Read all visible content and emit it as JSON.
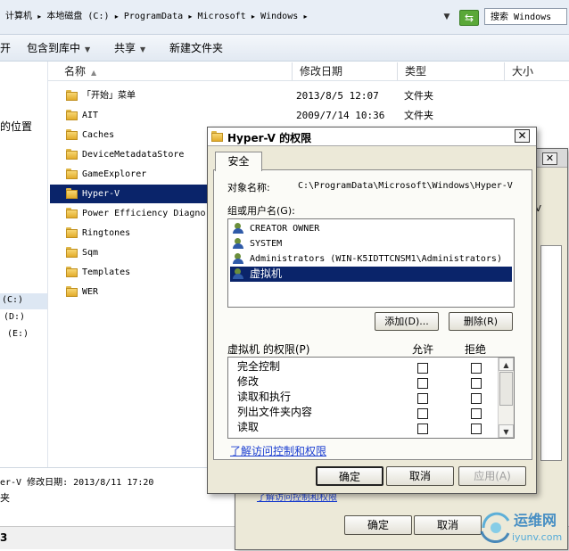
{
  "explorer": {
    "breadcrumb": [
      "计算机",
      "本地磁盘 (C:)",
      "ProgramData",
      "Microsoft",
      "Windows"
    ],
    "search_placeholder": "搜索 Windows",
    "toolbar": {
      "open": "开",
      "include_in_library": "包含到库中",
      "share": "共享",
      "new_folder": "新建文件夹"
    },
    "nav": {
      "location": "的位置",
      "drive_c": "(C:)",
      "drive_d": "(D:)",
      "drive_e": "(E:)"
    },
    "columns": {
      "name": "名称",
      "date": "修改日期",
      "type": "类型",
      "size": "大小"
    },
    "files": [
      {
        "name": "「开始」菜单",
        "date": "2013/8/5 12:07",
        "type": "文件夹"
      },
      {
        "name": "AIT",
        "date": "2009/7/14 10:36",
        "type": "文件夹"
      },
      {
        "name": "Caches"
      },
      {
        "name": "DeviceMetadataStore"
      },
      {
        "name": "GameExplorer"
      },
      {
        "name": "Hyper-V"
      },
      {
        "name": "Power Efficiency Diagno"
      },
      {
        "name": "Ringtones"
      },
      {
        "name": "Sqm"
      },
      {
        "name": "Templates"
      },
      {
        "name": "WER"
      }
    ],
    "details": {
      "line1": "er-V  修改日期: 2013/8/11 17:20",
      "line2": "夹"
    },
    "status": "3"
  },
  "back_dialog": {
    "ok": "确定",
    "cancel": "取消",
    "v": "V",
    "link_partial": "了解访问控制和权限"
  },
  "dialog": {
    "title": "Hyper-V 的权限",
    "close": "✕",
    "tab": "安全",
    "object_label": "对象名称:",
    "object_path": "C:\\ProgramData\\Microsoft\\Windows\\Hyper-V",
    "group_label": "组或用户名(G):",
    "users": [
      "CREATOR OWNER",
      "SYSTEM",
      "Administrators (WIN-K5IDTTCNSM1\\Administrators)",
      "虚拟机"
    ],
    "add": "添加(D)...",
    "remove": "删除(R)",
    "perm_label": "虚拟机 的权限(P)",
    "allow": "允许",
    "deny": "拒绝",
    "permissions": [
      "完全控制",
      "修改",
      "读取和执行",
      "列出文件夹内容",
      "读取"
    ],
    "link": "了解访问控制和权限",
    "ok": "确定",
    "cancel": "取消",
    "apply": "应用(A)"
  },
  "watermark": {
    "text": "运维网",
    "domain": "iyunv.com"
  },
  "colors": {
    "selection": "#0a246a",
    "dialog_bg": "#ece9d8",
    "link": "#1c3fd1"
  }
}
